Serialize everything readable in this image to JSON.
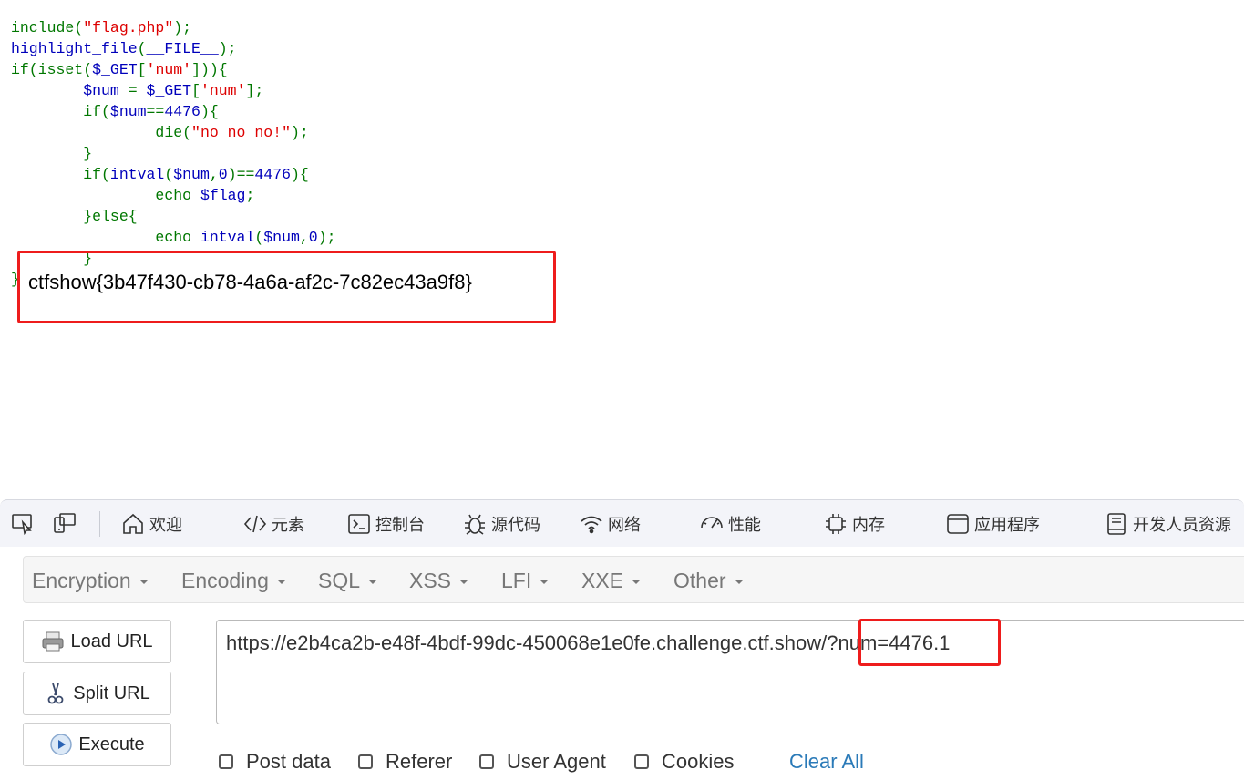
{
  "page": {
    "code_lines": [
      [
        {
          "t": "include(",
          "c": "kw"
        },
        {
          "t": "\"flag.php\"",
          "c": "str"
        },
        {
          "t": ");",
          "c": "kw"
        }
      ],
      [
        {
          "t": "highlight_file",
          "c": "def"
        },
        {
          "t": "(",
          "c": "kw"
        },
        {
          "t": "__FILE__",
          "c": "def"
        },
        {
          "t": ");",
          "c": "kw"
        }
      ],
      [
        {
          "t": "if(isset(",
          "c": "kw"
        },
        {
          "t": "$_GET",
          "c": "def"
        },
        {
          "t": "[",
          "c": "kw"
        },
        {
          "t": "'num'",
          "c": "str"
        },
        {
          "t": "])){",
          "c": "kw"
        }
      ],
      [
        {
          "t": "        ",
          "c": "kw"
        },
        {
          "t": "$num ",
          "c": "def"
        },
        {
          "t": "= ",
          "c": "kw"
        },
        {
          "t": "$_GET",
          "c": "def"
        },
        {
          "t": "[",
          "c": "kw"
        },
        {
          "t": "'num'",
          "c": "str"
        },
        {
          "t": "];",
          "c": "kw"
        }
      ],
      [
        {
          "t": "        if(",
          "c": "kw"
        },
        {
          "t": "$num",
          "c": "def"
        },
        {
          "t": "==",
          "c": "kw"
        },
        {
          "t": "4476",
          "c": "def"
        },
        {
          "t": "){",
          "c": "kw"
        }
      ],
      [
        {
          "t": "                die(",
          "c": "kw"
        },
        {
          "t": "\"no no no!\"",
          "c": "str"
        },
        {
          "t": ");",
          "c": "kw"
        }
      ],
      [
        {
          "t": "        }",
          "c": "kw"
        }
      ],
      [
        {
          "t": "        if(",
          "c": "kw"
        },
        {
          "t": "intval",
          "c": "def"
        },
        {
          "t": "(",
          "c": "kw"
        },
        {
          "t": "$num",
          "c": "def"
        },
        {
          "t": ",",
          "c": "kw"
        },
        {
          "t": "0",
          "c": "def"
        },
        {
          "t": ")==",
          "c": "kw"
        },
        {
          "t": "4476",
          "c": "def"
        },
        {
          "t": "){",
          "c": "kw"
        }
      ],
      [
        {
          "t": "                echo ",
          "c": "kw"
        },
        {
          "t": "$flag",
          "c": "def"
        },
        {
          "t": ";",
          "c": "kw"
        }
      ],
      [
        {
          "t": "        }else{",
          "c": "kw"
        }
      ],
      [
        {
          "t": "                echo ",
          "c": "kw"
        },
        {
          "t": "intval",
          "c": "def"
        },
        {
          "t": "(",
          "c": "kw"
        },
        {
          "t": "$num",
          "c": "def"
        },
        {
          "t": ",",
          "c": "kw"
        },
        {
          "t": "0",
          "c": "def"
        },
        {
          "t": ");",
          "c": "kw"
        }
      ],
      [
        {
          "t": "        }",
          "c": "kw"
        }
      ],
      [
        {
          "t": "}",
          "c": "kw"
        }
      ]
    ],
    "flag_output": "ctfshow{3b47f430-cb78-4a6a-af2c-7c82ec43a9f8}"
  },
  "devtools": {
    "tabs": [
      {
        "label": "欢迎",
        "icon": "home-icon"
      },
      {
        "label": "元素",
        "icon": "code-icon"
      },
      {
        "label": "控制台",
        "icon": "console-icon"
      },
      {
        "label": "源代码",
        "icon": "bug-icon"
      },
      {
        "label": "网络",
        "icon": "wifi-icon"
      },
      {
        "label": "性能",
        "icon": "gauge-icon"
      },
      {
        "label": "内存",
        "icon": "chip-icon"
      },
      {
        "label": "应用程序",
        "icon": "app-window-icon"
      },
      {
        "label": "开发人员资源",
        "icon": "book-icon"
      }
    ]
  },
  "hackbar": {
    "menu": [
      "Encryption",
      "Encoding",
      "SQL",
      "XSS",
      "LFI",
      "XXE",
      "Other"
    ],
    "buttons": {
      "load": "Load URL",
      "split": "Split URL",
      "execute": "Execute"
    },
    "url": "https://e2b4ca2b-e48f-4bdf-99dc-450068e1e0fe.challenge.ctf.show/?num=4476.1",
    "checkboxes": [
      "Post data",
      "Referer",
      "User Agent",
      "Cookies"
    ],
    "clear_all": "Clear All"
  },
  "colors": {
    "highlight_box": "#ee1c1c",
    "php_keyword": "#007700",
    "php_default": "#0000BB",
    "php_string": "#DD0000",
    "link": "#2a7ab8"
  }
}
